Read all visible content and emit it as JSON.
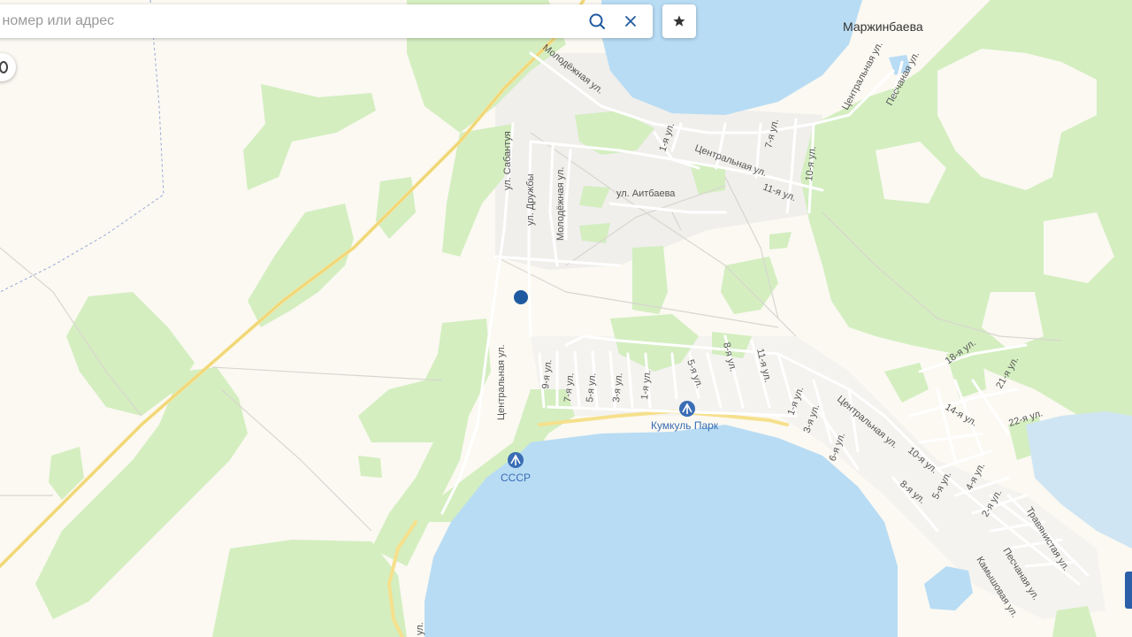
{
  "search": {
    "placeholder": "те номер или адрес"
  },
  "map": {
    "settlement_labels": [
      "Маржинбаева"
    ],
    "streets": [
      "Молодёжная ул.",
      "Центральная ул.",
      "Песчаная ул.",
      "ул. Сабантуя",
      "ул. Дружбы",
      "Молодёжная ул.",
      "ул. Аитбаева",
      "1-я ул.",
      "Центральная ул.",
      "7-я ул.",
      "10-я ул.",
      "11-я ул.",
      "Центральная ул.",
      "9-я ул.",
      "7-я ул.",
      "5-я ул.",
      "3-я ул.",
      "1-я ул.",
      "5-я ул.",
      "8-я ул.",
      "11-я ул.",
      "1-я ул.",
      "3-я ул.",
      "6-я ул.",
      "Центральная ул.",
      "18-я ул.",
      "21-я ул.",
      "14-я ул.",
      "22-я ул.",
      "10-я ул.",
      "5-я ул.",
      "4-я ул.",
      "8-я ул.",
      "2-я ул.",
      "Травянистая ул.",
      "Песчаная ул.",
      "Камышовая ул.",
      "ул."
    ],
    "pois": [
      "Кумкуль Парк",
      "СССР"
    ],
    "marker": "location-marker",
    "colors": {
      "land": "#fbf9f2",
      "forest": "#d4eec0",
      "water": "#b8dcf4",
      "road_major": "#f6e08c",
      "road_minor": "#ffffff",
      "marker": "#1f5aa0",
      "poi": "#3a6db5"
    }
  },
  "buttons": {
    "search_icon": "search-icon",
    "clear_icon": "close-icon",
    "favorite_icon": "star-icon"
  }
}
